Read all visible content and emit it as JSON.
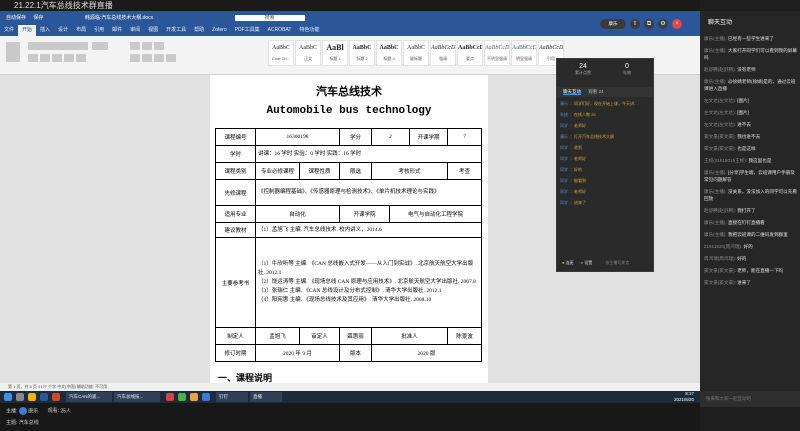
{
  "live": {
    "title": "21.22.1汽车总线技术群直播",
    "host_label": "主播:",
    "host_name": "康乐",
    "viewers_label": "观看:",
    "viewers": "25人",
    "topic_label": "主题:",
    "topic": "汽车总线"
  },
  "word": {
    "quick_access": [
      "自动保存",
      "保存"
    ],
    "doc_name": "韩源临:汽车总线技术大纲.docx",
    "search_hint": "搜索",
    "tabs": [
      "文件",
      "开始",
      "插入",
      "设计",
      "布局",
      "引用",
      "邮件",
      "审阅",
      "视图",
      "开发工具",
      "帮助",
      "Zotero",
      "PDF工具集",
      "ACROBAT",
      "特色功能"
    ],
    "active_tab": "开始",
    "styles": [
      {
        "sample": "AaBbC",
        "name": "Char Ch..."
      },
      {
        "sample": "AaBbC",
        "name": "正文"
      },
      {
        "sample": "AaBl",
        "name": "标题 1"
      },
      {
        "sample": "AaBbC",
        "name": "标题 2"
      },
      {
        "sample": "AaBbC",
        "name": "标题 3"
      },
      {
        "sample": "AaBbC",
        "name": "副标题"
      },
      {
        "sample": "AaBbCcD",
        "name": "强调"
      },
      {
        "sample": "AaBbCcD",
        "name": "要点"
      },
      {
        "sample": "AaBbCcD",
        "name": "不明显强调"
      },
      {
        "sample": "AaBbCcD",
        "name": "明显强调"
      },
      {
        "sample": "AaBbCcD",
        "name": "引用"
      }
    ],
    "doc": {
      "title_cn": "汽车总线技术",
      "title_en": "Automobile bus technology",
      "rows": {
        "code_label": "课程编号",
        "code": "16300198",
        "credit_label": "学分",
        "credit": "2",
        "term_label": "开课学期",
        "term": "7",
        "hours_label": "学时",
        "hours_text": "讲课：16 学时   实验：0 学时   实践：16 学时",
        "cat_label": "课程类别",
        "cat": "专业必修课程",
        "nature_label": "课程性质",
        "nature": "限选",
        "exam_label": "考核形式",
        "exam": "考查",
        "prereq_label": "先修课程",
        "prereq": "《控制器编程基础》、《传感器原理与检测技术》、《单片机技术理论与实践》",
        "major_label": "适用专业",
        "major": "自动化",
        "school_label": "开课学院",
        "school": "电气与自动化工程学院",
        "textbook_label": "建议教材",
        "textbook": "（1）孟旭飞 主编. 汽车总线技术. 校内讲义，2014.6",
        "refs_label": "主要参考书",
        "refs": [
          "（1）牛欣听等 主编. 《CAN 总线嵌入式开发——从入门到实战》. 北京航天航空大学出版社. 2012.1",
          "（2）饶运涛等 主编. 《现场总线 CAN 原理与应用技术》. 北京航天航空大学出版社. 2007.8",
          "（3）张瑞仁 主编. 《CAN 总线设计及分布式控制》. 清华大学出版社. 2012.1",
          "（4）阳宪惠 主编. 《现场总线技术及其应用》. 清华大学出版社. 2008.10"
        ],
        "author_label": "制定人",
        "author": "孟旭飞",
        "reviewer_label": "审定人",
        "reviewer": "薛惠丽",
        "approver_label": "批准人",
        "approver": "陈景波",
        "rev_label": "修订时期",
        "rev": "2020 年 9 月",
        "ver_label": "版本",
        "ver": "2020 版"
      },
      "section": "一、课程说明"
    },
    "status": "第 1 页，共 8 页   4127 个字   中文(中国)   辅助功能: 不可用"
  },
  "live_panel": {
    "likes": "24",
    "likes_label": "累计点赞",
    "gifts": "0",
    "gifts_label": "礼物",
    "tab_chat": "聊天互动",
    "tab_viewers": "观看 24",
    "messages": [
      {
        "n": "康乐",
        "t": "：同学们好，现在开始上课，今天讲…"
      },
      {
        "n": "系统",
        "t": "：在线人数 25"
      },
      {
        "n": "同学",
        "t": "：老师好"
      },
      {
        "n": "康乐",
        "t": "：打开汽车总线技术大纲"
      },
      {
        "n": "同学",
        "t": "：收到"
      },
      {
        "n": "同学",
        "t": "：老师好"
      },
      {
        "n": "同学",
        "t": "：好的"
      },
      {
        "n": "同学",
        "t": "：能看到"
      },
      {
        "n": "同学",
        "t": "：老师好"
      },
      {
        "n": "同学",
        "t": "：进来了"
      }
    ],
    "mic": "连麦",
    "settings": "设置",
    "footer": "仅主播可发言"
  },
  "top_right": {
    "badge": "康乐"
  },
  "chat": {
    "title": "聊天互动",
    "items": [
      {
        "u": "康乐(主播):",
        "t": "已经有一些学生进来了"
      },
      {
        "u": "康乐(主播):",
        "t": "大家打开同学们可以看到我的屏幕吗"
      },
      {
        "u": "赵舒腾(赵舒腾):",
        "t": "没有老师"
      },
      {
        "u": "康乐(主播):",
        "t": "@徐婧老师(徐婧)是的，通过云班课进入直播"
      },
      {
        "u": "左文达(左文达):",
        "t": "[图片]"
      },
      {
        "u": "左文达(左文达):",
        "t": "[图片]"
      },
      {
        "u": "左文达(左文达):",
        "t": "进不去"
      },
      {
        "u": "窦文豪(窦文豪):",
        "t": "我也进不去"
      },
      {
        "u": "窦文豪(窦文豪):",
        "t": "也是这样"
      },
      {
        "u": "王桢(21618015王桢):",
        "t": "我这里也是"
      },
      {
        "u": "康乐(主播):",
        "t": "[分享]学生端，云班课用户手册及常见问题解答"
      },
      {
        "u": "康乐(主播):",
        "t": "没关系，没法加入的同学可以先看回放"
      },
      {
        "u": "赵舒腾(赵舒腾):",
        "t": "我打开了"
      },
      {
        "u": "康乐(主播):",
        "t": "直接在钉钉直播看"
      },
      {
        "u": "康乐(主播):",
        "t": "我把云班课的二维码发到群里"
      },
      {
        "u": "21611820(周鸿瑞):",
        "t": "好的"
      },
      {
        "u": "周鸿瑞(周鸿瑞):",
        "t": "好的"
      },
      {
        "u": "窦文豪(窦文豪):",
        "t": "老师，能在直播一下吗"
      },
      {
        "u": "窦文豪(窦文豪):",
        "t": "进来了"
      }
    ],
    "input_placeholder": "快来和大家一起互动吧"
  },
  "taskbar": {
    "apps": [
      "汽车CAN的遥...",
      "汽车总线技...",
      "钉钉",
      "直播"
    ],
    "time": "8:17",
    "date": "2021/8/30"
  }
}
